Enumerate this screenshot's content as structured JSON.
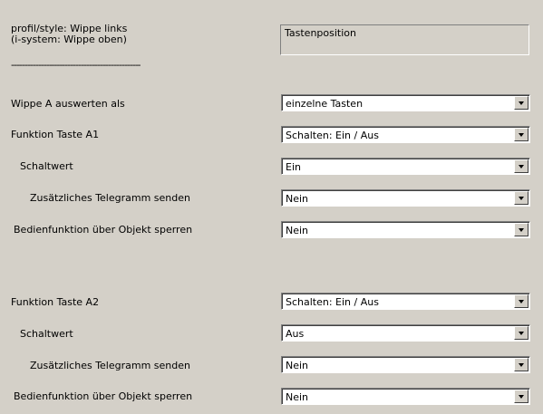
{
  "header": {
    "line1": "profil/style: Wippe links",
    "line2": "(i-system: Wippe oben)",
    "value": "Tastenposition"
  },
  "separator": "------------------------------------------------",
  "rows": [
    {
      "label": "Wippe A auswerten als",
      "value": "einzelne Tasten"
    },
    {
      "label": "Funktion Taste A1",
      "value": "Schalten: Ein / Aus"
    },
    {
      "label": "Schaltwert",
      "value": "Ein"
    },
    {
      "label": "Zusätzliches Telegramm senden",
      "value": "Nein"
    },
    {
      "label": "Bedienfunktion über Objekt sperren",
      "value": "Nein"
    },
    {
      "label": "Funktion Taste A2",
      "value": "Schalten: Ein / Aus"
    },
    {
      "label": "Schaltwert",
      "value": "Aus"
    },
    {
      "label": "Zusätzliches Telegramm senden",
      "value": "Nein"
    },
    {
      "label": "Bedienfunktion über Objekt sperren",
      "value": "Nein"
    }
  ]
}
